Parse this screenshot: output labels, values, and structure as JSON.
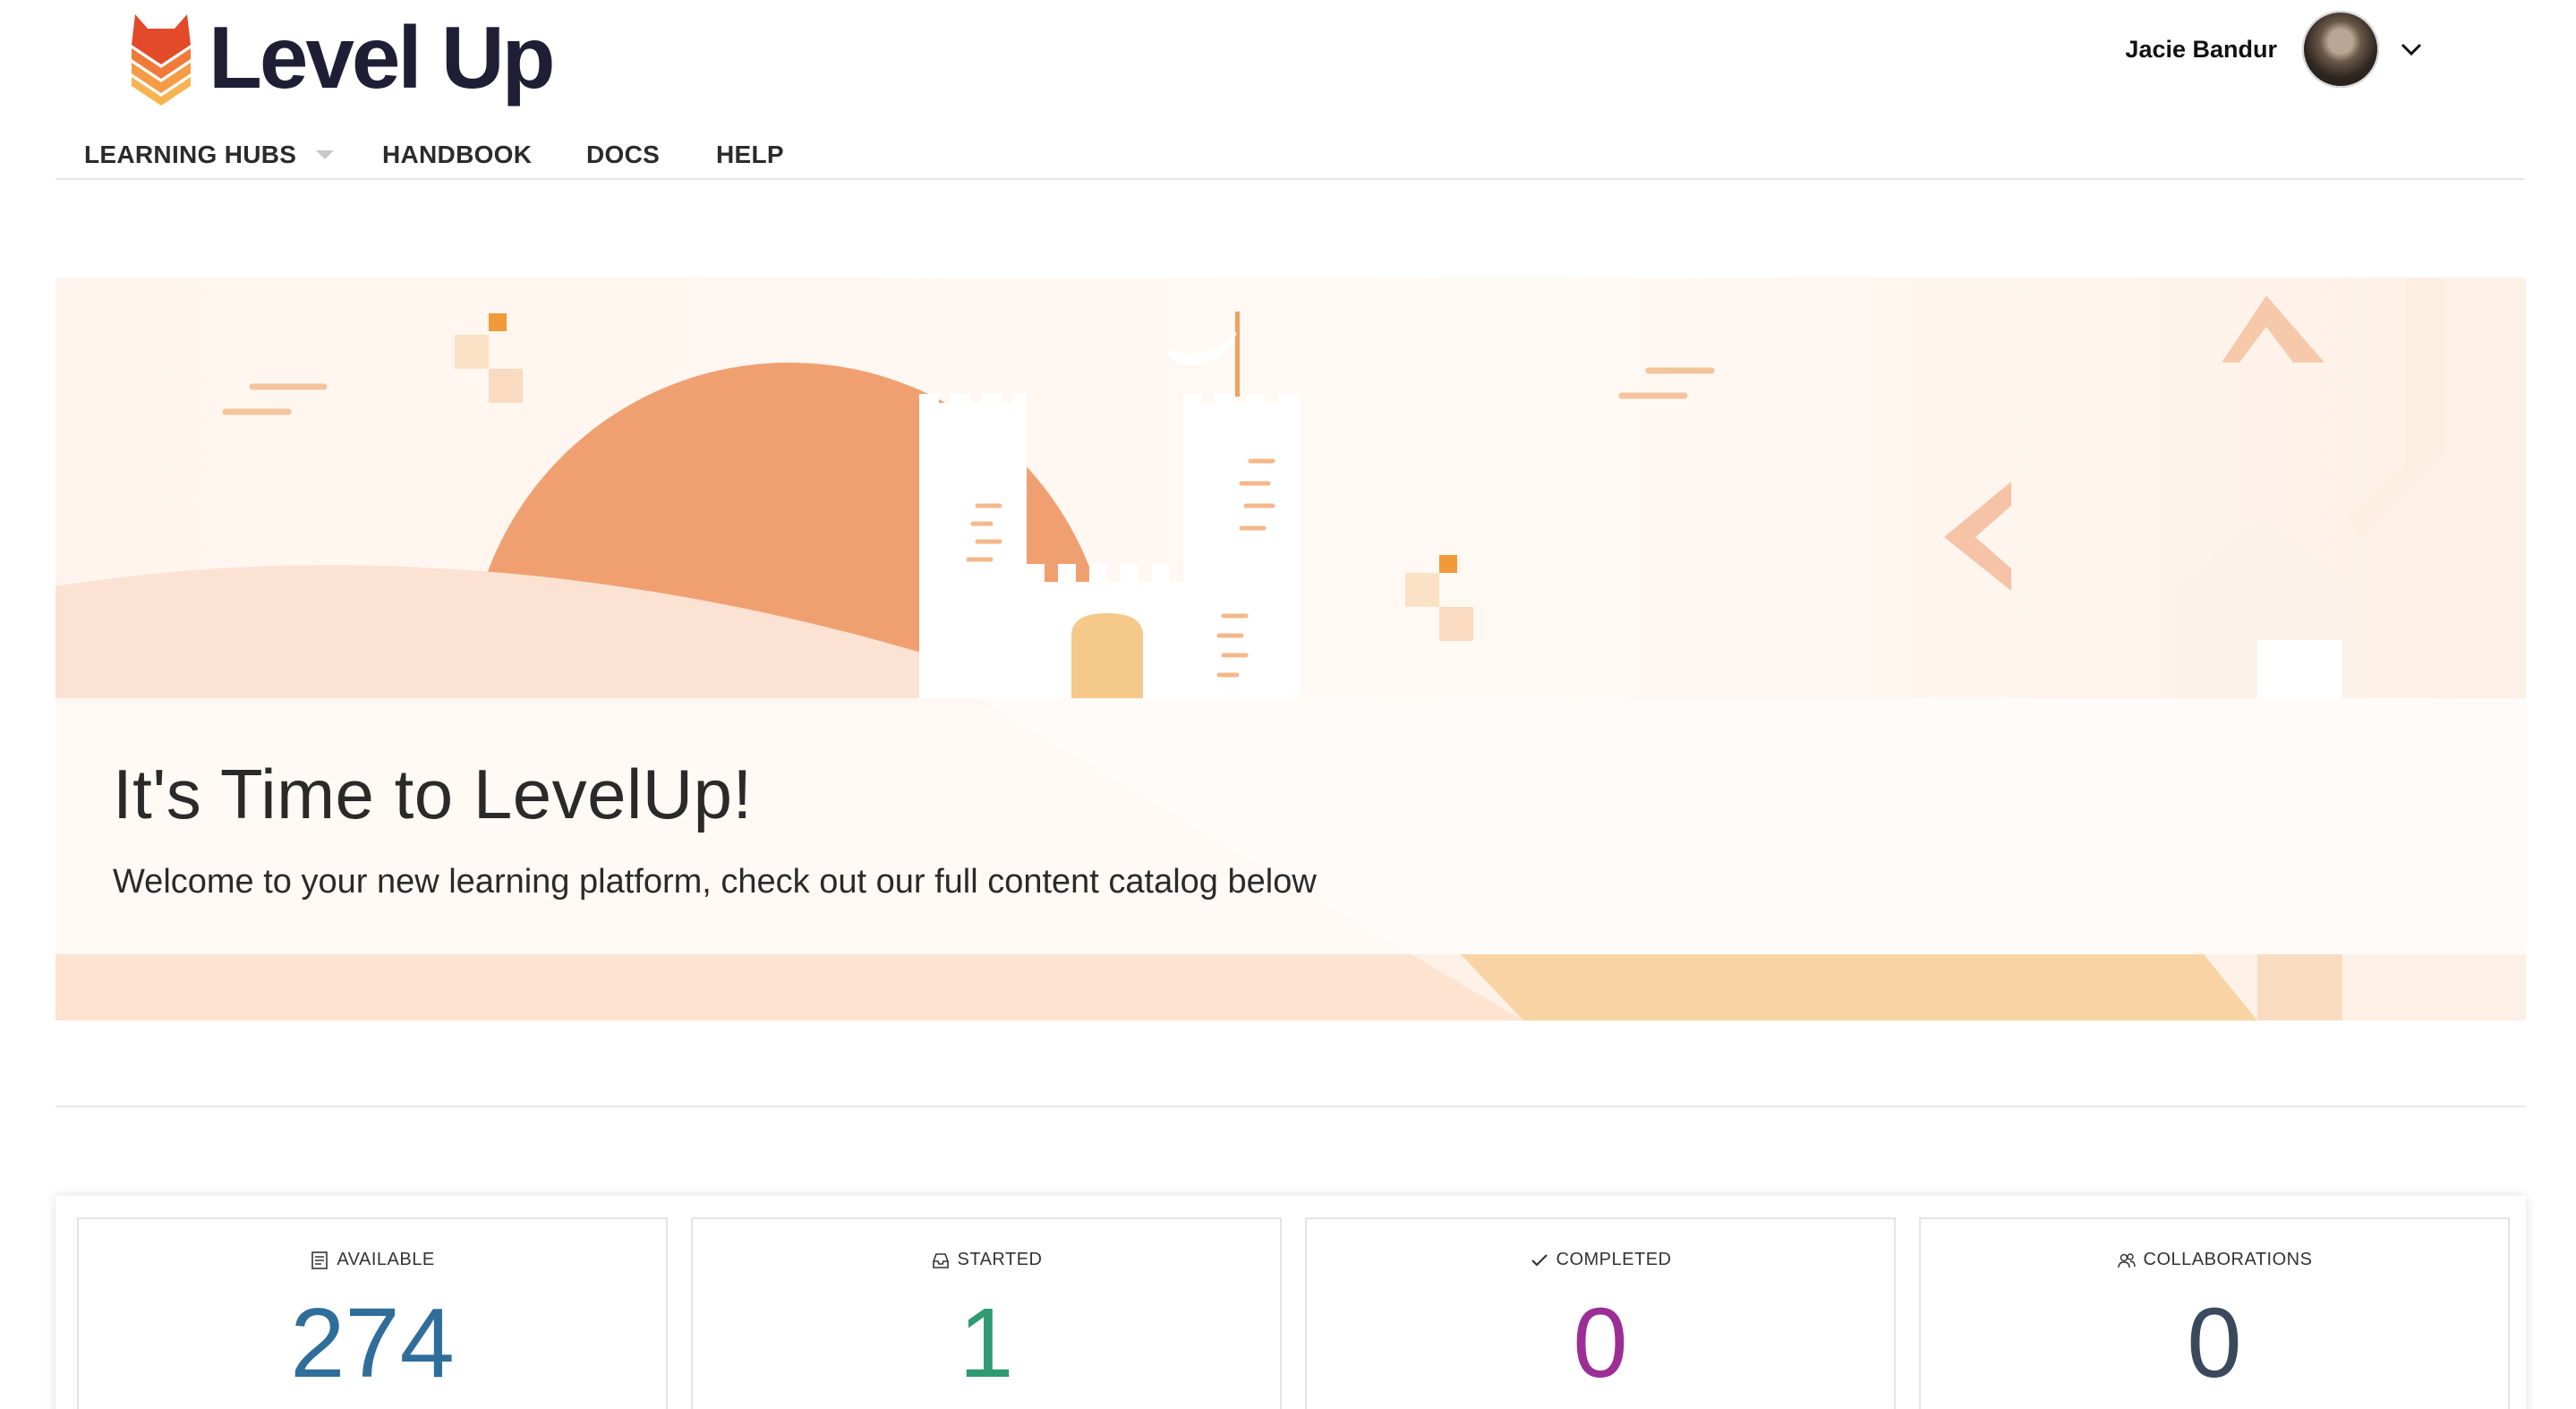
{
  "header": {
    "logo_text": "Level Up",
    "user_name": "Jacie Bandur"
  },
  "nav": {
    "items": [
      {
        "label": "LEARNING HUBS",
        "has_dropdown": true
      },
      {
        "label": "HANDBOOK",
        "has_dropdown": false
      },
      {
        "label": "DOCS",
        "has_dropdown": false
      },
      {
        "label": "HELP",
        "has_dropdown": false
      }
    ]
  },
  "hero": {
    "title": "It's Time to LevelUp!",
    "subtitle": "Welcome to your new learning platform, check out our full content catalog below"
  },
  "stats": [
    {
      "label": "AVAILABLE",
      "value": "274",
      "icon": "catalog-icon",
      "color": "#2f6e9a"
    },
    {
      "label": "STARTED",
      "value": "1",
      "icon": "inbox-icon",
      "color": "#2e9a72"
    },
    {
      "label": "COMPLETED",
      "value": "0",
      "icon": "check-icon",
      "color": "#9b2f96"
    },
    {
      "label": "COLLABORATIONS",
      "value": "0",
      "icon": "users-icon",
      "color": "#3a4a5c"
    }
  ],
  "colors": {
    "brand_orange": "#e9673c",
    "sun": "#f0a070",
    "sand": "#f8d4a4",
    "text_dark": "#1f1e35"
  }
}
